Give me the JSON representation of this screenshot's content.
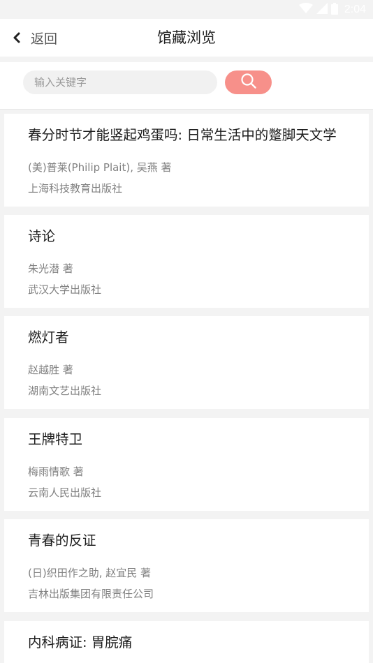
{
  "status": {
    "time": "2:04",
    "icons": [
      "wifi-icon",
      "cell-signal-icon",
      "battery-icon"
    ]
  },
  "nav": {
    "back_label": "返回",
    "title": "馆藏浏览"
  },
  "search": {
    "placeholder": "输入关键字",
    "button_icon": "search-icon"
  },
  "colors": {
    "accent": "#f7908a",
    "background": "#f3f3f3",
    "card": "#ffffff",
    "secondary_text": "#808080"
  },
  "books": [
    {
      "title": "春分时节才能竖起鸡蛋吗: 日常生活中的蹩脚天文学",
      "author": "(美)普莱(Philip Plait), 吴燕  著",
      "publisher": "上海科技教育出版社"
    },
    {
      "title": "诗论",
      "author": "朱光潜  著",
      "publisher": "武汉大学出版社"
    },
    {
      "title": "燃灯者",
      "author": "赵越胜  著",
      "publisher": "湖南文艺出版社"
    },
    {
      "title": "王牌特卫",
      "author": "梅雨情歌  著",
      "publisher": "云南人民出版社"
    },
    {
      "title": "青春的反证",
      "author": "(日)织田作之助, 赵宜民  著",
      "publisher": "吉林出版集团有限责任公司"
    },
    {
      "title": "内科病证: 胃脘痛",
      "author": "",
      "publisher": ""
    }
  ]
}
